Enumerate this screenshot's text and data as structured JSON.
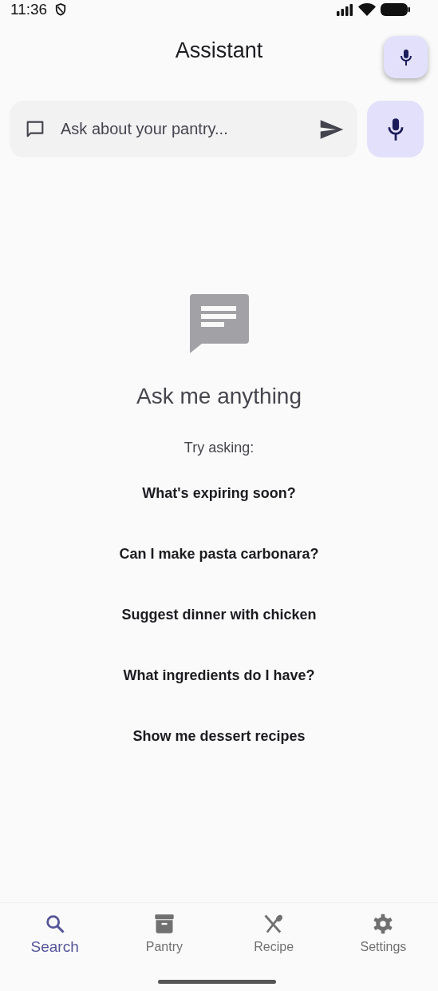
{
  "status_bar": {
    "time": "11:36"
  },
  "header": {
    "title": "Assistant"
  },
  "search": {
    "placeholder": "Ask about your pantry..."
  },
  "empty_state": {
    "title": "Ask me anything",
    "subtitle": "Try asking:"
  },
  "suggestions": [
    "What's expiring soon?",
    "Can I make pasta carbonara?",
    "Suggest dinner with chicken",
    "What ingredients do I have?",
    "Show me dessert recipes"
  ],
  "nav": [
    {
      "label": "Search",
      "kind": "search",
      "selected": true
    },
    {
      "label": "Pantry",
      "kind": "pantry",
      "selected": false
    },
    {
      "label": "Recipe",
      "kind": "recipe",
      "selected": false
    },
    {
      "label": "Settings",
      "kind": "settings",
      "selected": false
    }
  ]
}
